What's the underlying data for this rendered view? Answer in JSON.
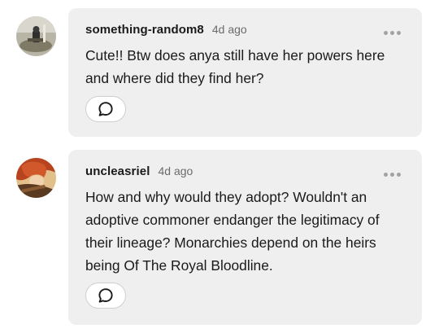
{
  "comments": [
    {
      "username": "something-random8",
      "timestamp": "4d ago",
      "text": "Cute!! Btw does anya still have her powers here and where did they find her?",
      "avatar_icon": "user-avatar-icon",
      "reply_icon": "speech-bubble-icon",
      "more_icon": "more-options-icon"
    },
    {
      "username": "uncleasriel",
      "timestamp": "4d ago",
      "text": "How and why would they adopt? Wouldn't an adoptive commoner endanger the legitimacy of their lineage? Monarchies depend on the heirs being Of The Royal Bloodline.",
      "avatar_icon": "user-avatar-icon",
      "reply_icon": "speech-bubble-icon",
      "more_icon": "more-options-icon"
    }
  ],
  "colors": {
    "bubble_bg": "#efefef",
    "text": "#1a1a1a",
    "muted": "#6b6b6b",
    "dots": "#a3a3a3"
  }
}
